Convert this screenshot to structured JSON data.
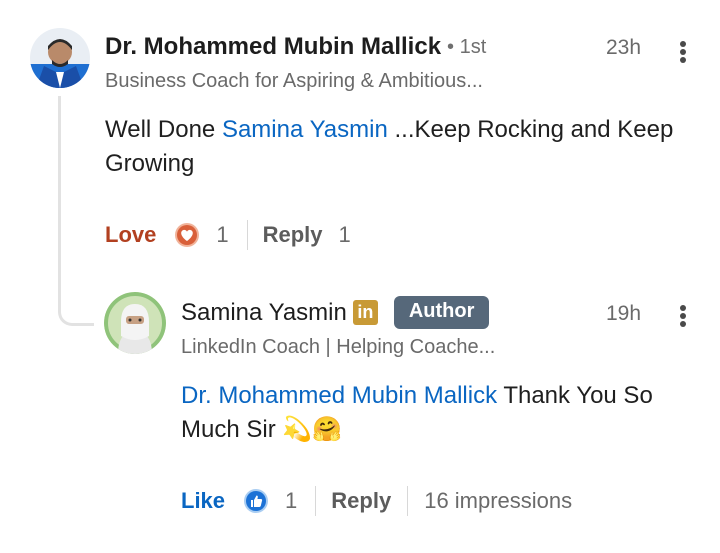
{
  "comment": {
    "author": "Dr. Mohammed Mubin Mallick",
    "degree": "• 1st",
    "headline": "Business Coach for Aspiring & Ambitious...",
    "time": "23h",
    "mention": "Samina Yasmin",
    "text_before": "Well Done ",
    "text_after": " ...Keep Rocking and Keep Growing",
    "reaction_label": "Love",
    "reaction_icon": "love-heart-icon",
    "reaction_count": "1",
    "reply_label": "Reply",
    "reply_count": "1"
  },
  "reply": {
    "author": "Samina Yasmin",
    "badge_text": "in",
    "author_tag": "Author",
    "headline": "LinkedIn Coach | Helping Coache...",
    "time": "19h",
    "mention": "Dr. Mohammed Mubin Mallick",
    "text_after": " Thank You So Much Sir ",
    "emoji": "💫🤗",
    "reaction_label": "Like",
    "reaction_icon": "thumbs-up-icon",
    "reaction_count": "1",
    "reply_label": "Reply",
    "impressions": "16 impressions"
  },
  "colors": {
    "link_blue": "#0a66c2",
    "love_red": "#b24020",
    "author_tag_bg": "#56687a",
    "linkedin_badge": "#c89a36"
  }
}
